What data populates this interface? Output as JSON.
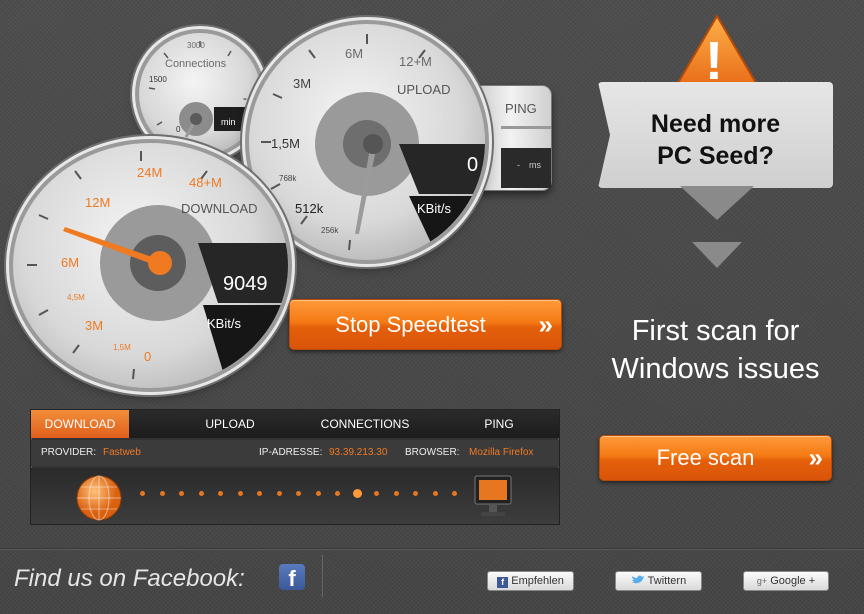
{
  "gauges": {
    "connections": {
      "title": "Connections",
      "ticks": [
        "3000",
        "1500",
        "0"
      ],
      "unit": "min",
      "readout": "-"
    },
    "upload": {
      "title": "UPLOAD",
      "ticks": [
        "6M",
        "12+M",
        "3M",
        "1,5M",
        "768k",
        "512k",
        "256k"
      ],
      "readout": "0",
      "unit": "KBit/s"
    },
    "ping": {
      "title": "PING",
      "readout": "-",
      "unit": "ms"
    },
    "download": {
      "title": "DOWNLOAD",
      "ticks": [
        "24M",
        "48+M",
        "12M",
        "6M",
        "4,5M",
        "3M",
        "1,5M",
        "0"
      ],
      "readout": "9049",
      "unit": "KBit/s"
    }
  },
  "stop_button": {
    "label": "Stop Speedtest",
    "chevron": "»"
  },
  "ad": {
    "headline_line1": "Need more",
    "headline_line2": "PC Seed?",
    "subline1": "First scan for",
    "subline2": "Windows issues",
    "cta": "Free scan",
    "cta_chevron": "»",
    "warning_glyph": "!"
  },
  "panel": {
    "tabs": [
      "DOWNLOAD",
      "UPLOAD",
      "CONNECTIONS",
      "PING"
    ],
    "active_tab": "DOWNLOAD",
    "provider_label": "PROVIDER:",
    "provider_value": "Fastweb",
    "ip_label": "IP-ADRESSE:",
    "ip_value": "93.39.213.30",
    "browser_label": "BROWSER:",
    "browser_value": "Mozilla Firefox"
  },
  "footer": {
    "facebook_text": "Find us on Facebook:",
    "facebook_glyph": "f",
    "like_label": "Empfehlen",
    "twitter_label": "Twittern",
    "google_label": "Google +",
    "google_glyph": "g+"
  },
  "colors": {
    "accent": "#ef7a22",
    "background": "#4a4a4a"
  },
  "progress": {
    "dots_total": 17,
    "active_dot_index": 11
  }
}
